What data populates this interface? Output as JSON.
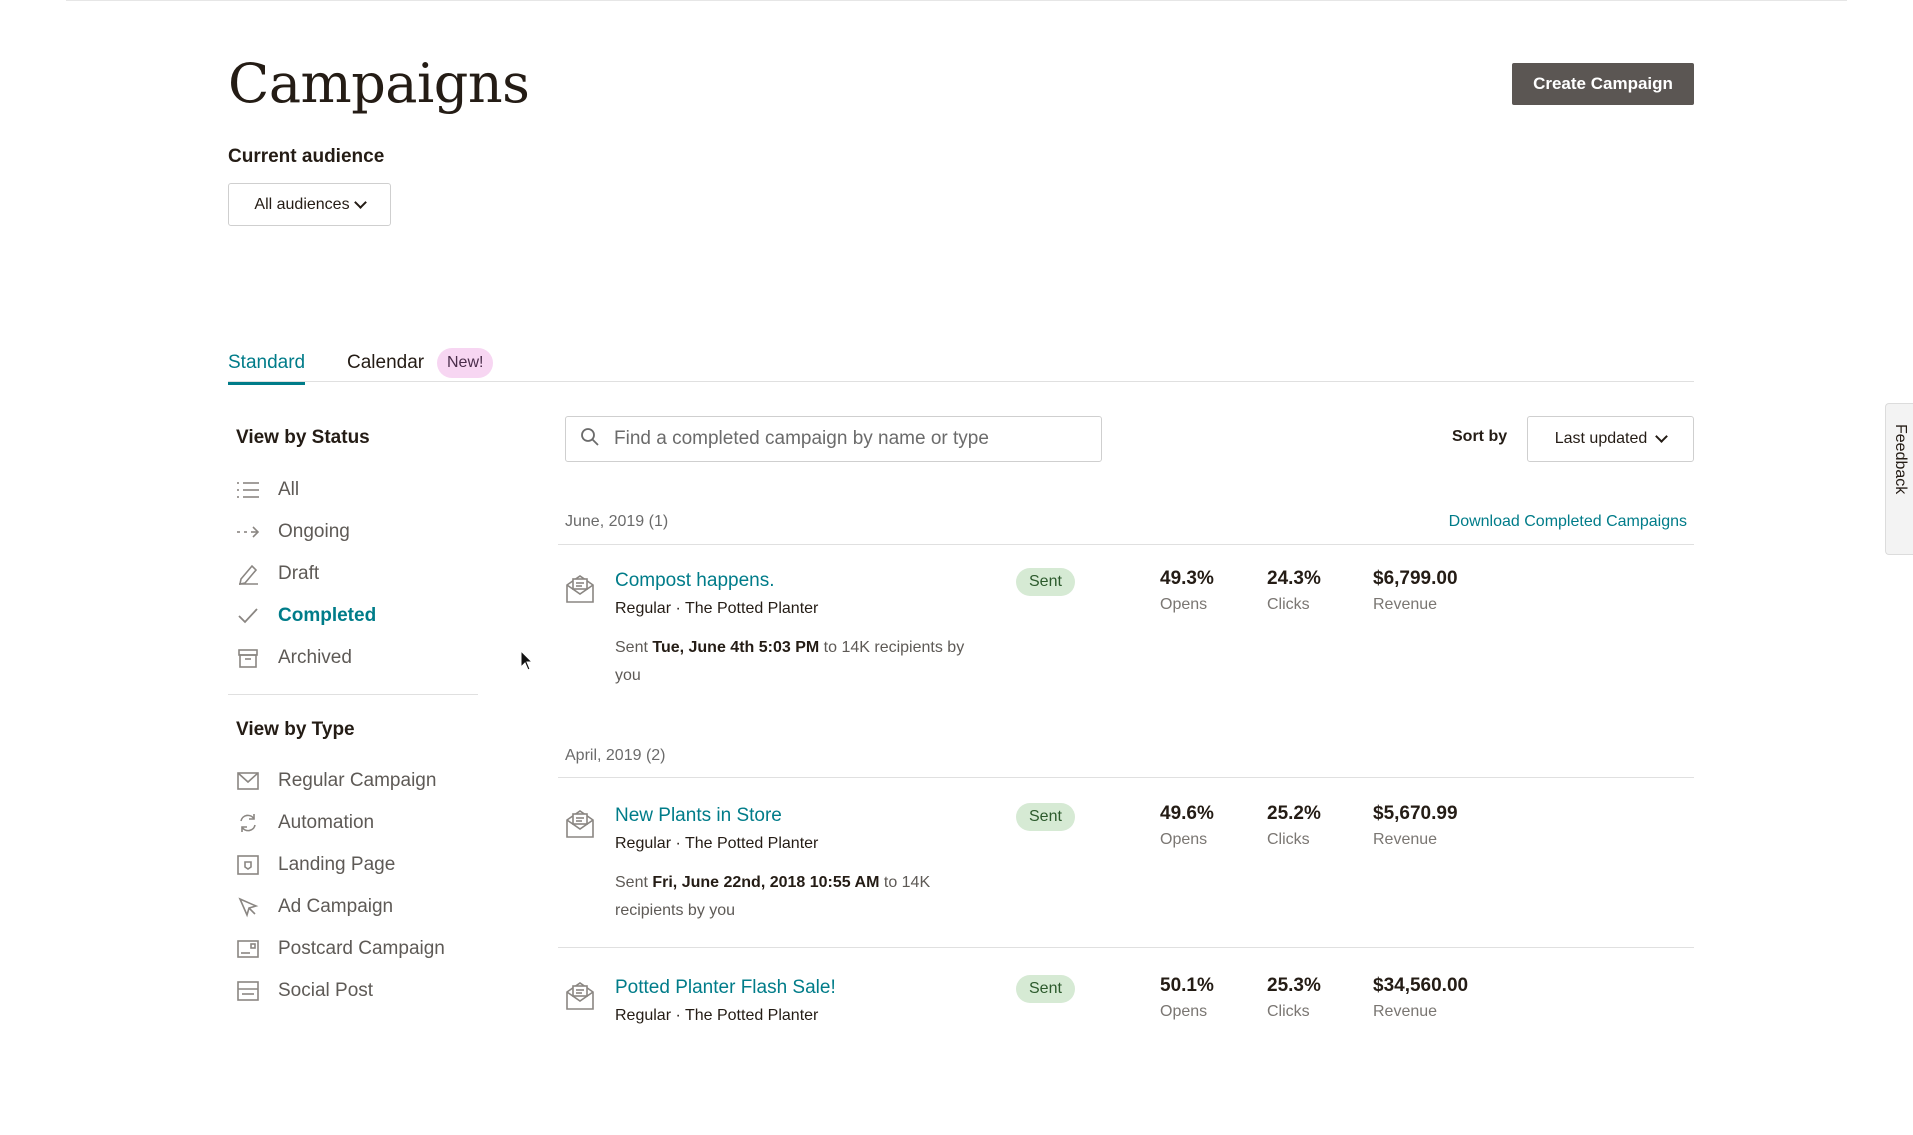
{
  "header": {
    "title": "Campaigns",
    "create_label": "Create Campaign",
    "audience_label": "Current audience",
    "audience_value": "All audiences"
  },
  "tabs": [
    {
      "label": "Standard",
      "active": true
    },
    {
      "label": "Calendar",
      "badge": "New!"
    }
  ],
  "sidebar": {
    "status_heading": "View by Status",
    "status_items": [
      {
        "label": "All",
        "icon": "list-icon"
      },
      {
        "label": "Ongoing",
        "icon": "dashed-arrow-icon"
      },
      {
        "label": "Draft",
        "icon": "pencil-icon"
      },
      {
        "label": "Completed",
        "icon": "check-icon",
        "active": true
      },
      {
        "label": "Archived",
        "icon": "archive-icon"
      }
    ],
    "type_heading": "View by Type",
    "type_items": [
      {
        "label": "Regular Campaign",
        "icon": "envelope-icon"
      },
      {
        "label": "Automation",
        "icon": "refresh-icon"
      },
      {
        "label": "Landing Page",
        "icon": "landing-page-icon"
      },
      {
        "label": "Ad Campaign",
        "icon": "cursor-arrow-icon"
      },
      {
        "label": "Postcard Campaign",
        "icon": "postcard-icon"
      },
      {
        "label": "Social Post",
        "icon": "social-post-icon"
      }
    ]
  },
  "search": {
    "placeholder": "Find a completed campaign by name or type"
  },
  "sort": {
    "label": "Sort by",
    "value": "Last updated"
  },
  "download_label": "Download Completed Campaigns",
  "groups": [
    {
      "label": "June, 2019 (1)",
      "campaigns": [
        {
          "name": "Compost happens.",
          "meta": "Regular · The Potted Planter",
          "sent_prefix": "Sent ",
          "sent_date": "Tue, June 4th 5:03 PM",
          "sent_suffix": " to 14K recipients by you",
          "status": "Sent",
          "opens": "49.3%",
          "opens_label": "Opens",
          "clicks": "24.3%",
          "clicks_label": "Clicks",
          "revenue": "$6,799.00",
          "revenue_label": "Revenue"
        }
      ]
    },
    {
      "label": "April, 2019 (2)",
      "campaigns": [
        {
          "name": "New Plants in Store",
          "meta": "Regular · The Potted Planter",
          "sent_prefix": "Sent ",
          "sent_date": "Fri, June 22nd, 2018 10:55 AM",
          "sent_suffix": " to 14K recipients by you",
          "status": "Sent",
          "opens": "49.6%",
          "opens_label": "Opens",
          "clicks": "25.2%",
          "clicks_label": "Clicks",
          "revenue": "$5,670.99",
          "revenue_label": "Revenue"
        },
        {
          "name": "Potted Planter Flash Sale!",
          "meta": "Regular · The Potted Planter",
          "status": "Sent",
          "opens": "50.1%",
          "opens_label": "Opens",
          "clicks": "25.3%",
          "clicks_label": "Clicks",
          "revenue": "$34,560.00",
          "revenue_label": "Revenue"
        }
      ]
    }
  ],
  "feedback_label": "Feedback",
  "colors": {
    "accent": "#007c89",
    "button": "#5b5653",
    "sent_badge": "#d6ead4",
    "new_badge": "#f7d6f2"
  }
}
